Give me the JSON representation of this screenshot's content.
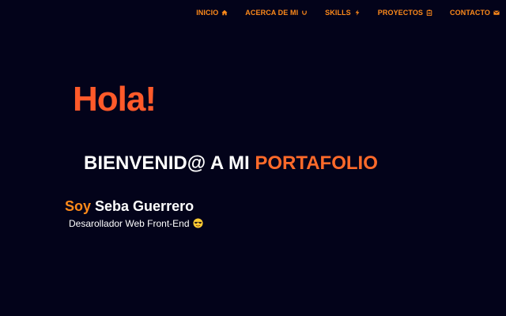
{
  "nav": {
    "items": [
      {
        "label": "INICIO",
        "icon": "home-icon"
      },
      {
        "label": "ACERCA DE MI",
        "icon": "smile-icon"
      },
      {
        "label": "SKILLS",
        "icon": "bolt-icon"
      },
      {
        "label": "PROYECTOS",
        "icon": "clipboard-icon"
      },
      {
        "label": "CONTACTO",
        "icon": "mail-icon"
      }
    ]
  },
  "hero": {
    "greeting": "Hola!",
    "welcome_prefix": "BIENVENID@ A MI",
    "welcome_accent": "PORTAFOLIO",
    "soy": "Soy",
    "name": "Seba Guerrero",
    "role": "Desarollador Web Front-End",
    "role_icon": "sunglasses-emoji-icon"
  },
  "colors": {
    "background": "#03031a",
    "nav_accent": "#ff8a1a",
    "greeting": "#ff5a2a",
    "text": "#ffffff"
  }
}
